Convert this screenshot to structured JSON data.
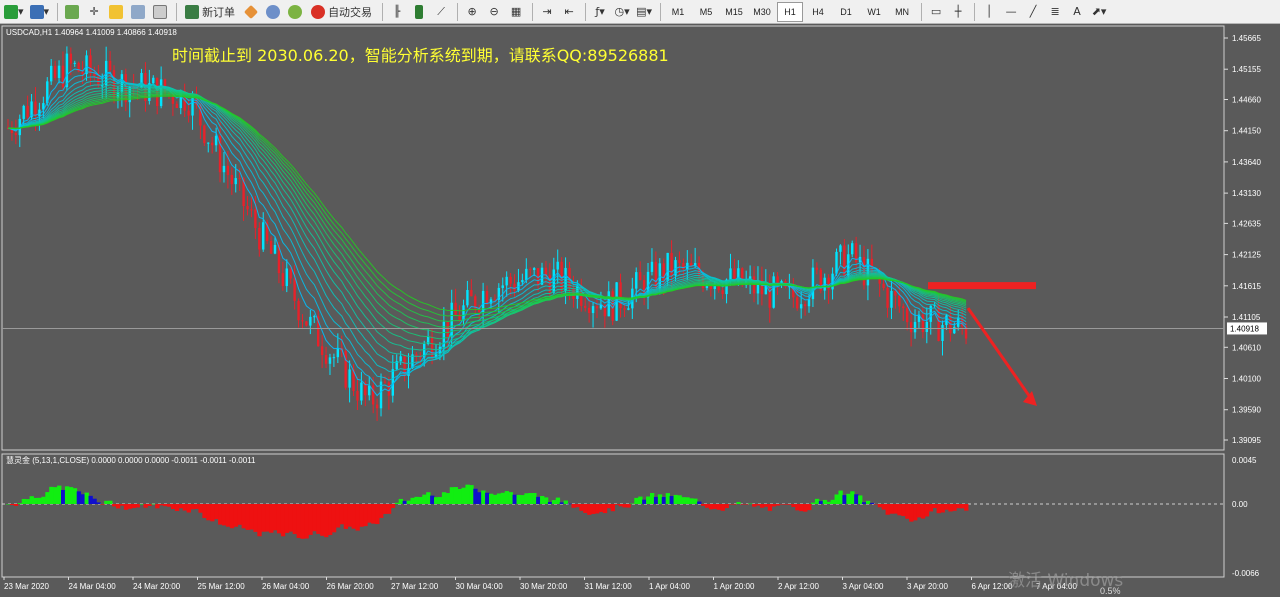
{
  "toolbar": {
    "new_order": "新订单",
    "auto_trade": "自动交易",
    "timeframes": [
      "M1",
      "M5",
      "M15",
      "M30",
      "H1",
      "H4",
      "D1",
      "W1",
      "MN"
    ],
    "active_timeframe": "H1"
  },
  "chart": {
    "title": "USDCAD,H1  1.40964 1.41009 1.40866 1.40918",
    "notice": "时间截止到 2030.06.20，智能分析系统到期，请联系QQ:89526881",
    "current_price": "1.40918",
    "price_axis": [
      "1.45665",
      "1.45155",
      "1.44660",
      "1.44150",
      "1.43640",
      "1.43130",
      "1.42635",
      "1.42125",
      "1.41615",
      "1.41105",
      "1.40610",
      "1.40100",
      "1.39590",
      "1.39095"
    ],
    "time_axis": [
      "23 Mar 2020",
      "24 Mar 04:00",
      "24 Mar 20:00",
      "25 Mar 12:00",
      "26 Mar 04:00",
      "26 Mar 20:00",
      "27 Mar 12:00",
      "30 Mar 04:00",
      "30 Mar 20:00",
      "31 Mar 12:00",
      "1 Apr 04:00",
      "1 Apr 20:00",
      "2 Apr 12:00",
      "3 Apr 04:00",
      "3 Apr 20:00",
      "6 Apr 12:00",
      "7 Apr 04:00"
    ]
  },
  "indicator": {
    "title": "慧灵金 (5,13,1,CLOSE) 0.0000 0.0000 0.0000 -0.0011 -0.0011 -0.0011",
    "axis": [
      "0.0045",
      "0.00",
      "-0.0066"
    ]
  },
  "watermark": "激活 Windows",
  "speed": "0.5%",
  "chart_data": {
    "type": "line",
    "title": "USDCAD,H1",
    "x": [
      "23 Mar 2020",
      "24 Mar 04:00",
      "24 Mar 20:00",
      "25 Mar 12:00",
      "26 Mar 04:00",
      "26 Mar 20:00",
      "27 Mar 12:00",
      "30 Mar 04:00",
      "30 Mar 20:00",
      "31 Mar 12:00",
      "1 Apr 04:00",
      "1 Apr 20:00",
      "2 Apr 12:00",
      "3 Apr 04:00",
      "3 Apr 20:00",
      "6 Apr 12:00",
      "7 Apr 04:00"
    ],
    "series": [
      {
        "values": [
          1.442,
          1.452,
          1.449,
          1.447,
          1.428,
          1.41,
          1.397,
          1.407,
          1.416,
          1.418,
          1.413,
          1.419,
          1.417,
          1.414,
          1.421,
          1.411,
          1.409
        ]
      }
    ],
    "ylim": [
      1.39095,
      1.45665
    ],
    "colors": {
      "up": "#00e5ff",
      "down": "#e8212a",
      "ribbon_fast": "#00bfff",
      "ribbon_slow": "#22cc22",
      "hist_pos": "#11ee11",
      "hist_neg": "#ee1111",
      "hist_blue": "#1010cc"
    }
  }
}
